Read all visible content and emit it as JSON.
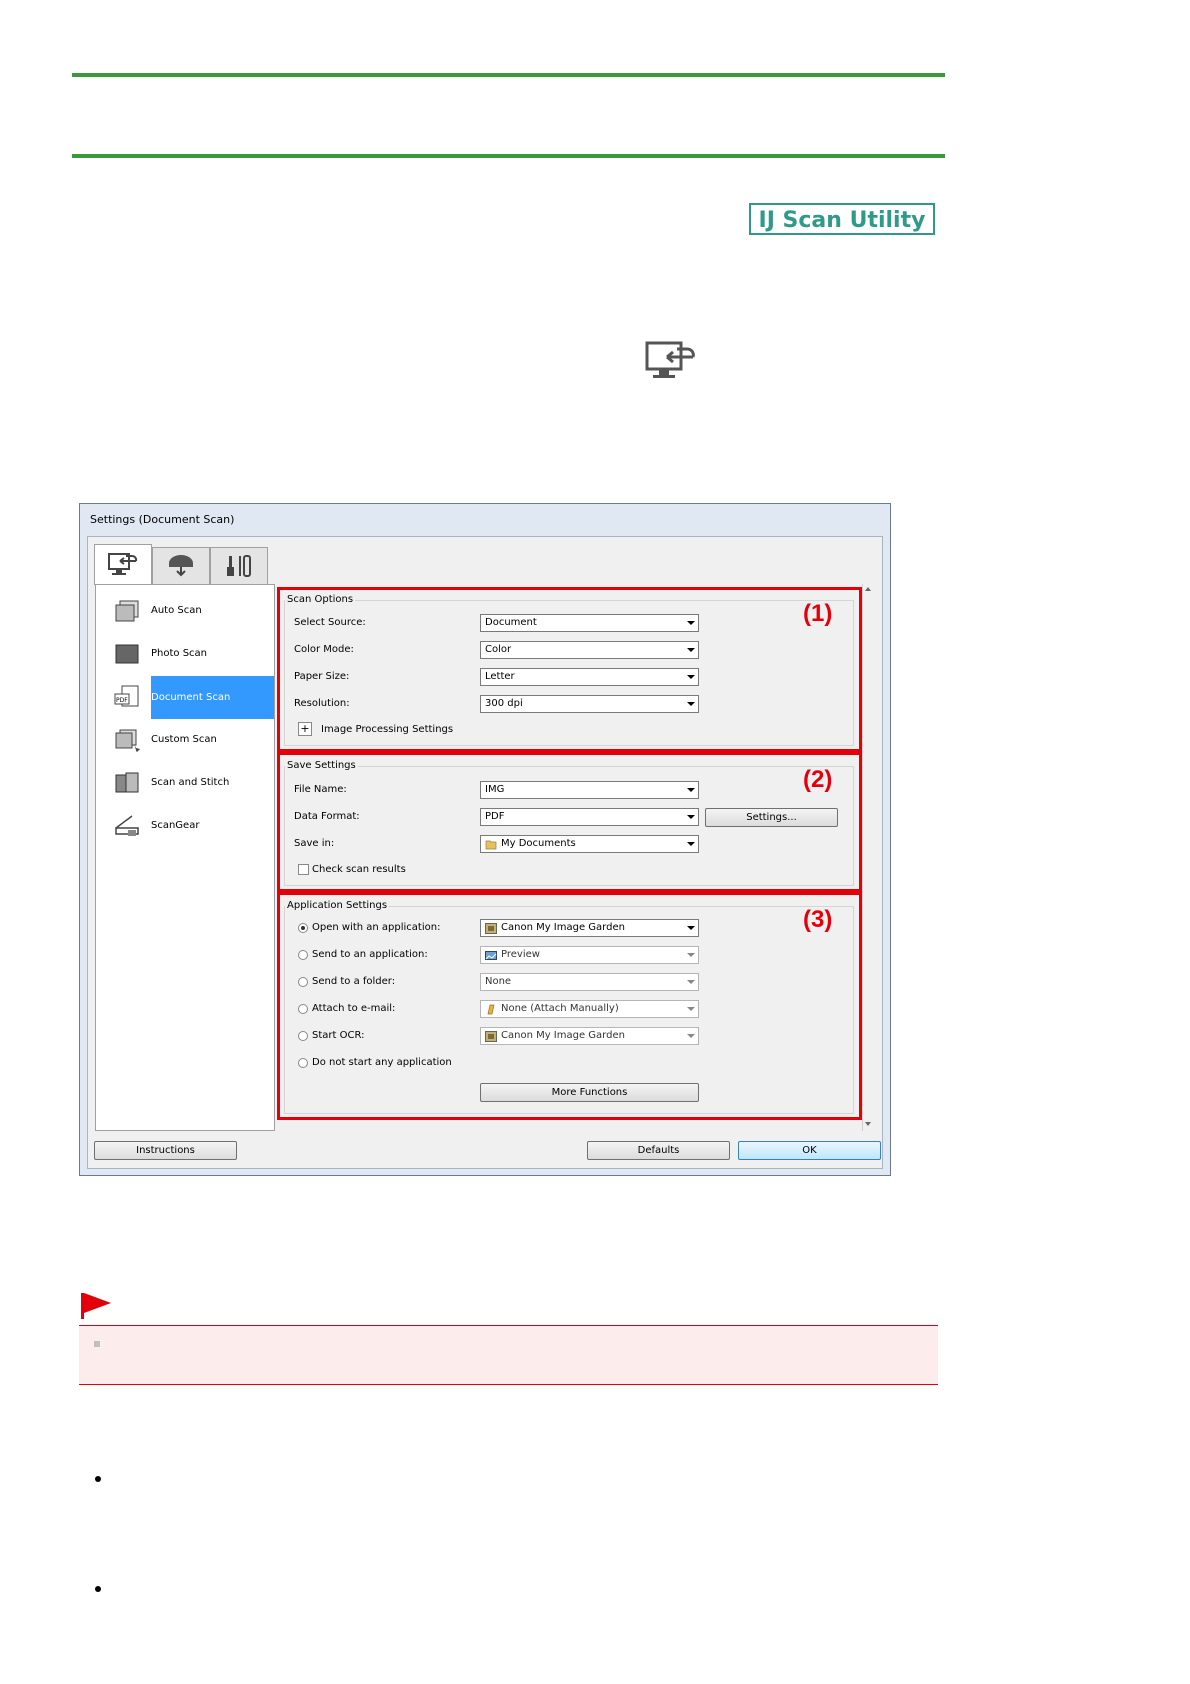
{
  "page": {
    "badge": "IJ Scan Utility"
  },
  "dialog": {
    "title": "Settings (Document Scan)",
    "tabs": [
      {
        "icon": "scan-from-computer-icon"
      },
      {
        "icon": "scan-from-panel-icon"
      },
      {
        "icon": "general-settings-icon"
      }
    ],
    "list": [
      {
        "label": "Auto Scan",
        "icon": "auto-scan-icon"
      },
      {
        "label": "Photo Scan",
        "icon": "photo-scan-icon"
      },
      {
        "label": "Document Scan",
        "icon": "document-scan-icon",
        "selected": true
      },
      {
        "label": "Custom Scan",
        "icon": "custom-scan-icon"
      },
      {
        "label": "Scan and Stitch",
        "icon": "scan-and-stitch-icon"
      },
      {
        "label": "ScanGear",
        "icon": "scangear-icon"
      }
    ],
    "scan_options": {
      "title": "Scan Options",
      "marker": "(1)",
      "select_source_label": "Select Source:",
      "select_source_value": "Document",
      "color_mode_label": "Color Mode:",
      "color_mode_value": "Color",
      "paper_size_label": "Paper Size:",
      "paper_size_value": "Letter",
      "resolution_label": "Resolution:",
      "resolution_value": "300 dpi",
      "expand_symbol": "+",
      "image_processing_label": "Image Processing Settings"
    },
    "save_settings": {
      "title": "Save Settings",
      "marker": "(2)",
      "file_name_label": "File Name:",
      "file_name_value": "IMG",
      "data_format_label": "Data Format:",
      "data_format_value": "PDF",
      "settings_button": "Settings...",
      "save_in_label": "Save in:",
      "save_in_value": "My Documents",
      "check_scan_results_label": "Check scan results"
    },
    "application_settings": {
      "title": "Application Settings",
      "marker": "(3)",
      "open_with_label": "Open with an application:",
      "open_with_value": "Canon My Image Garden",
      "send_to_app_label": "Send to an application:",
      "send_to_app_value": "Preview",
      "send_to_folder_label": "Send to a folder:",
      "send_to_folder_value": "None",
      "attach_email_label": "Attach to e-mail:",
      "attach_email_value": "None (Attach Manually)",
      "start_ocr_label": "Start OCR:",
      "start_ocr_value": "Canon My Image Garden",
      "do_not_start_label": "Do not start any application",
      "more_functions_button": "More Functions"
    },
    "buttons": {
      "instructions": "Instructions",
      "defaults": "Defaults",
      "ok": "OK"
    }
  },
  "colors": {
    "green_rule": "#3a9a3a",
    "badge": "#2f9a8a",
    "highlight": "#e3000b",
    "selection": "#3399ff",
    "note_bg": "#fcecec"
  }
}
